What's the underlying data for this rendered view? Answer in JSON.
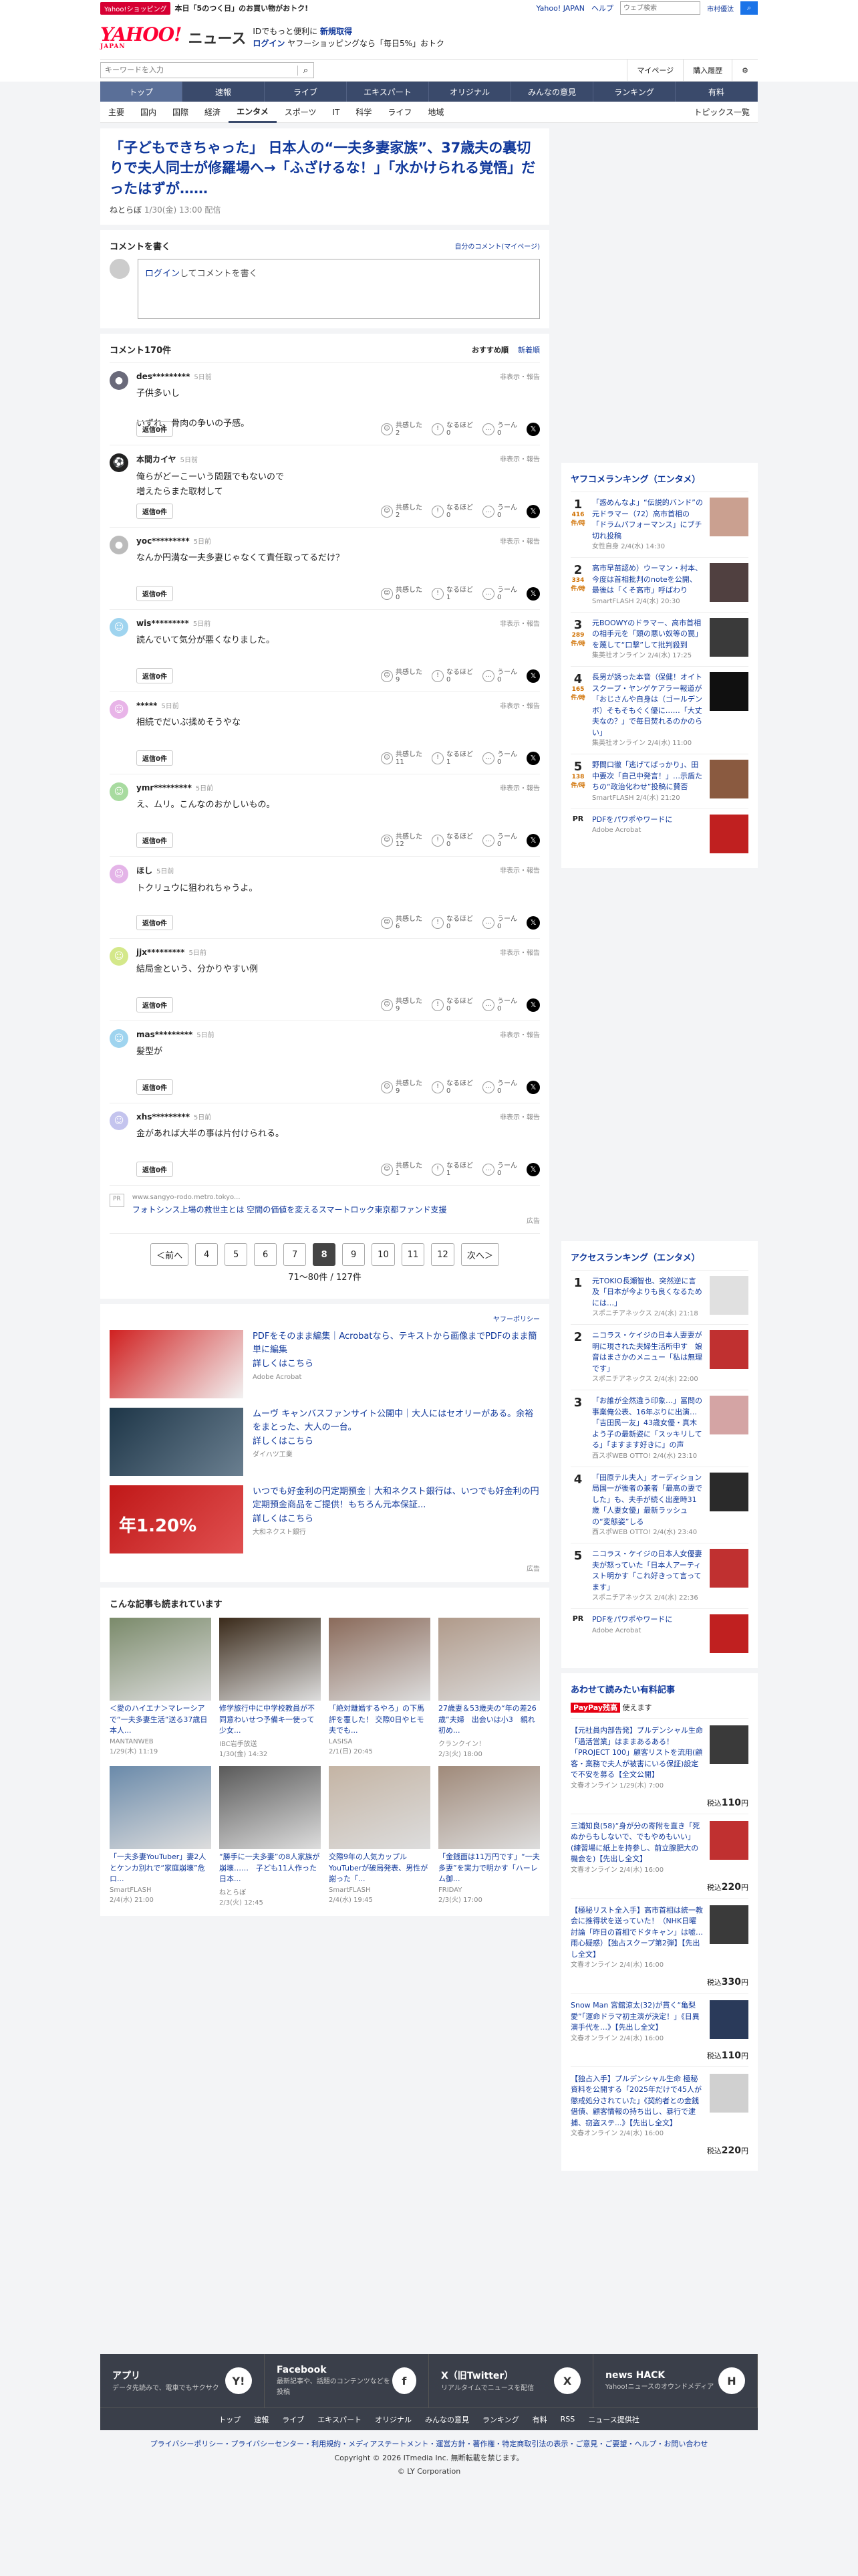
{
  "promo": {
    "tag": "Yahoo!ショッピング",
    "text": "本日「5のつく日」のお買い物がおトク!",
    "links": [
      "Yahoo! JAPAN",
      "ヘルプ"
    ],
    "search_placeholder": "ウェブ検索",
    "search_btn": "市村優汰"
  },
  "header": {
    "logo": "YAHOO!",
    "logo_sub": "JAPAN",
    "brand": "ニュース",
    "msg1": "IDでもっと便利に",
    "msg1b": "新規取得",
    "msg2": "ログイン",
    "msg2b": "ヤフーショッピングなら「毎日5%」おトク"
  },
  "searchbar": {
    "placeholder": "キーワードを入力",
    "links": [
      "マイページ",
      "購入履歴"
    ]
  },
  "nav1": [
    "トップ",
    "速報",
    "ライブ",
    "エキスパート",
    "オリジナル",
    "みんなの意見",
    "ランキング",
    "有料"
  ],
  "nav2": [
    "主要",
    "国内",
    "国際",
    "経済",
    "エンタメ",
    "スポーツ",
    "IT",
    "科学",
    "ライフ",
    "地域"
  ],
  "nav2_right": "トピックス一覧",
  "article": {
    "title": "「子どもできちゃった」 日本人の“一夫多妻家族”、37歳夫の裏切りで夫人同士が修羅場へ→「ふざけるな！」「水かけられる覚悟」だったはずが……",
    "source": "ねとらぼ",
    "date": "1/30(金) 13:00 配信"
  },
  "comment_form": {
    "title": "コメントを書く",
    "mine": "自分のコメント(マイページ)",
    "login": "ログイン",
    "rest": "してコメントを書く"
  },
  "comments_head": {
    "count": "コメント170件",
    "sort_on": "おすすめ順",
    "sort_off": "新着順"
  },
  "comment_labels": {
    "report": "非表示・報告",
    "reply": "返信0件",
    "agree": "共感した",
    "nice": "なるほど",
    "hmm": "うーん"
  },
  "comments": [
    {
      "user": "des*********",
      "time": "5日前",
      "text": "子供多いし\n\nいずれ、骨肉の争いの予感。",
      "a": "2",
      "b": "0",
      "c": "0",
      "color": "#6a6a7a",
      "icon": "●"
    },
    {
      "user": "本間カイヤ",
      "time": "5日前",
      "text": "俺らがどーこーいう問題でもないので\n増えたらまた取材して",
      "a": "2",
      "b": "0",
      "c": "0",
      "color": "#222",
      "icon": "⚽"
    },
    {
      "user": "yoc*********",
      "time": "5日前",
      "text": "なんか円満な一夫多妻じゃなくて責任取ってるだけ？",
      "a": "0",
      "b": "1",
      "c": "0",
      "color": "#bbb",
      "icon": "●"
    },
    {
      "user": "wis*********",
      "time": "5日前",
      "text": "読んでいて気分が悪くなりました。",
      "a": "9",
      "b": "0",
      "c": "0",
      "color": "#9fd4ef",
      "icon": "☺"
    },
    {
      "user": "*****",
      "time": "5日前",
      "text": "相続でだいぶ揉めそうやな",
      "a": "11",
      "b": "1",
      "c": "0",
      "color": "#e8b4e8",
      "icon": "☺"
    },
    {
      "user": "ymr*********",
      "time": "5日前",
      "text": "え、ムリ。こんなのおかしいもの。",
      "a": "12",
      "b": "0",
      "c": "0",
      "color": "#a8dba0",
      "icon": "☺"
    },
    {
      "user": "ほし",
      "time": "5日前",
      "text": "トクリュウに狙われちゃうよ。",
      "a": "6",
      "b": "0",
      "c": "0",
      "color": "#e4b4e8",
      "icon": "☺"
    },
    {
      "user": "jjx*********",
      "time": "5日前",
      "text": "結局金という、分かりやすい例",
      "a": "9",
      "b": "0",
      "c": "0",
      "color": "#d4e88a",
      "icon": "☺"
    },
    {
      "user": "mas*********",
      "time": "5日前",
      "text": "髪型が",
      "a": "9",
      "b": "0",
      "c": "0",
      "color": "#9fd4ef",
      "icon": "☺"
    },
    {
      "user": "xhs*********",
      "time": "5日前",
      "text": "金があれば大半の事は片付けられる。",
      "a": "1",
      "b": "1",
      "c": "0",
      "color": "#c4c4ee",
      "icon": "☺"
    }
  ],
  "pr_strip": {
    "badge": "PR",
    "src": "www.sangyo-rodo.metro.tokyo...",
    "title": "フォトシンス上場の救世主とは 空間の価値を変えるスマートロック東京都ファンド支援",
    "note": "広告"
  },
  "pager": {
    "prev": "＜前へ",
    "pages": [
      "4",
      "5",
      "6",
      "7",
      "8",
      "9",
      "10",
      "11",
      "12"
    ],
    "current": "8",
    "next": "次へ＞",
    "count": "71〜80件 / 127件"
  },
  "ads": {
    "policy": "ヤフーポリシー",
    "items": [
      {
        "title": "PDFをそのまま編集｜Acrobatなら、テキストから画像までPDFのまま簡単に編集",
        "more": "詳しくはこちら",
        "src": "Adobe Acrobat",
        "c1": "#d02020",
        "c2": "#f2f2f2"
      },
      {
        "title": "ムーヴ キャンバスファンサイト公開中｜大人にはセオリーがある。余裕をまとった、大人の一台。",
        "more": "詳しくはこちら",
        "src": "ダイハツ工業",
        "c1": "#1e3648",
        "c2": "#6a7f90"
      },
      {
        "title": "いつでも好金利の円定期預金｜大和ネクスト銀行は、いつでも好金利の円定期預金商品をご提供！もちろん元本保証...",
        "more": "詳しくはこちら",
        "src": "大和ネクスト銀行",
        "c1": "#c01818",
        "c2": "#e05050",
        "rate": "年1.20%"
      }
    ],
    "note": "広告"
  },
  "also": {
    "title": "こんな記事も読まれています",
    "items": [
      {
        "title": "＜愛のハイエナ＞マレーシアで“一夫多妻生活”送る37歳日本人...",
        "src": "MANTANWEB",
        "date": "1/29(木) 11:19",
        "c": "#7a8a6a"
      },
      {
        "title": "修学旅行中に中学校教員が不同意わいせつ予備キ一使って少女...",
        "src": "IBC岩手放送",
        "date": "1/30(金) 14:32",
        "c": "#3a2a1a"
      },
      {
        "title": "「絶対離婚するやろ」の下馬評を覆した！ 交際0日やヒモ夫でも...",
        "src": "LASISA",
        "date": "2/1(日) 20:45",
        "c": "#8a6a5a"
      },
      {
        "title": "27歳妻＆53歳夫の“年の差26歳”夫婦　出会いは小3　親れ初め...",
        "src": "クランクイン！",
        "date": "2/3(火) 18:00",
        "c": "#b09a8a"
      },
      {
        "title": "「一夫多妻YouTuber」妻2人とケンカ別れで“家庭崩壊”危ロ...",
        "src": "SmartFLASH",
        "date": "2/4(水) 21:00",
        "c": "#6a8aaa"
      },
      {
        "title": "“勝手に一夫多妻”の8人家族が崩壊……　子ども11人作った日本...",
        "src": "ねとらぼ",
        "date": "2/3(火) 12:45",
        "c": "#5a5a5a"
      },
      {
        "title": "交際9年の人気カップルYouTuberが破局発表、男性が謝った「...",
        "src": "SmartFLASH",
        "date": "2/4(水) 19:45",
        "c": "#c4b4a4"
      },
      {
        "title": "「金銭面は11万円です」“一夫多妻”を実力で明かす「ハーレム御...",
        "src": "FRIDAY",
        "date": "2/3(火) 17:00",
        "c": "#a08a7a"
      }
    ]
  },
  "ranking": {
    "title": "ヤフコメランキング（エンタメ）",
    "unit": "件/時",
    "items": [
      {
        "n": "1",
        "cnt": "416",
        "title": "「惑めんなよ」“伝説的バンド”の元ドラマー（72）高市首相の「ドラムパフォーマンス」にブチ切れ投稿",
        "src": "女性自身 2/4(水) 14:30",
        "c": "#caa090"
      },
      {
        "n": "2",
        "cnt": "334",
        "title": "高市早苗認め）ウーマン・村本、今度は首相批判のnoteを公開、最後は「くそ高市」呼ばわり",
        "src": "SmartFLASH 2/4(水) 20:30",
        "c": "#504040"
      },
      {
        "n": "3",
        "cnt": "289",
        "title": "元BOOWYのドラマー、高市首相の相手元を「頭の悪い奴等の罠」を蔑して“口撃”して批判殺到",
        "src": "集英社オンライン 2/4(水) 17:25",
        "c": "#3a3a3a"
      },
      {
        "n": "4",
        "cnt": "165",
        "title": "長男が誘った本音（保健！オイトスクープ・ヤンゲケアラー報道が「おじさんや自身は（ゴールデンボ）そもそもぐく優に……「大丈夫なの？」で毎日焚れるのかのらい」",
        "src": "集英社オンライン 2/4(水) 11:00",
        "c": "#101010"
      },
      {
        "n": "5",
        "cnt": "138",
        "title": "野間口徹「逃げてばっかり」、田中要次「自己中発言！」…示盾たちの“政治化わせ”投稿に賛否",
        "src": "SmartFLASH 2/4(水) 21:20",
        "c": "#8a5a40"
      }
    ],
    "pr": {
      "title": "PDFをパワポやワードに",
      "src": "Adobe Acrobat"
    }
  },
  "access": {
    "title": "アクセスランキング（エンタメ）",
    "items": [
      {
        "n": "1",
        "title": "元TOKIO長瀬智也、突然逆に言及「日本が今よりも良くなるためには…」",
        "src": "スポニチアネックス 2/4(水) 21:18",
        "c": "#e0e0e0"
      },
      {
        "n": "2",
        "title": "ニコラス・ケイジの日本人妻妻が明に現された夫婦生活所申す　娘音はまさかのメニュー「私は無理です」",
        "src": "スポニチアネックス 2/4(水) 22:00",
        "c": "#c03030"
      },
      {
        "n": "3",
        "title": "「お誰が全然違う印象…」冨問の事業俺公表、16年ぶりに出演…「吉田民一友」43歳女優・真木よう子の最新姿に「スッキリしてる」「ますます好きに」の声",
        "src": "西スポWEB OTTO! 2/4(水) 23:10",
        "c": "#d4a4a4"
      },
      {
        "n": "4",
        "title": "「田原テル夫人」オーディション局国一が後者の兼者「最高の妻でした」も、夫手が続く出産時31歳「人妻女優」最新ラッシュの“変態姿”しる",
        "src": "西スポWEB OTTO! 2/4(水) 23:40",
        "c": "#2a2a2a"
      },
      {
        "n": "5",
        "title": "ニコラス・ケイジの日本人女優妻夫が怒っていた「日本人アーティスト明かす「これ好きって言ってます」",
        "src": "スポニチアネックス 2/4(水) 22:36",
        "c": "#c03030"
      }
    ],
    "pr": {
      "title": "PDFをパワポやワードに",
      "src": "Adobe Acrobat"
    }
  },
  "paid": {
    "title": "あわせて読みたい有料記事",
    "paypay": "PayPay残高",
    "paypay_note": "使えます",
    "items": [
      {
        "title": "【元社員内部告発】プルデンシャル生命「過活営業」はままあるある！「PROJECT 100」顧客リストを流用(顧客・業務で夫人が被害にいる保証)設定で不安を募る【全文公開】",
        "src": "文春オンライン 1/29(木) 7:00",
        "price": "110",
        "c": "#3a3a3a"
      },
      {
        "title": "三浦知良(58)“身が分の寄附を直き「死ぬからもしないで、でもやめもいい」(練習場に紙上を持参し、前立腺肥大の機会を)【先出し全文】",
        "src": "文春オンライン 2/4(水) 16:00",
        "price": "220",
        "c": "#c03030"
      },
      {
        "title": "【極秘リスト全入手】高市首相は統一教会に推得状を送っていた！（NHK日曜討論「昨日の首相でドタキャン」は嘘…雨心疑惑）【独占スクープ第2弾】【先出し全文】",
        "src": "文春オンライン 2/4(水) 16:00",
        "price": "330",
        "c": "#3a3a3a"
      },
      {
        "title": "Snow Man 宮舘涼太(32)が貫く“亀梨愛”「運命ドラマ初主演が決定！」《日異演手代を…》【先出し全文】",
        "src": "文春オンライン 2/4(水) 16:00",
        "price": "110",
        "c": "#2a3a5a"
      },
      {
        "title": "【独占入手】プルデンシャル生命 極秘資料を公開する「2025年だけで45人が懲戒処分されていた」《契約者との金銭借債、顧客情報の持ち出し、暴行で逮捕、窃盗ステ...》【先出し全文】",
        "src": "文春オンライン 2/4(水) 16:00",
        "price": "220",
        "c": "#d0d0d0"
      }
    ],
    "price_prefix": "税込",
    "price_suffix": "円"
  },
  "footer": {
    "apps": [
      {
        "title": "アプリ",
        "desc": "データ先読みで、電車でもサクサク",
        "icon": "Y!"
      },
      {
        "title": "Facebook",
        "desc": "最新記事や、話題のコンテンツなどを投稿",
        "icon": "f"
      },
      {
        "title": "X（旧Twitter）",
        "desc": "リアルタイムでニュースを配信",
        "icon": "X"
      },
      {
        "title": "news HACK",
        "desc": "Yahoo!ニュースのオウンドメディア",
        "icon": "H"
      }
    ],
    "nav": [
      "トップ",
      "速報",
      "ライブ",
      "エキスパート",
      "オリジナル",
      "みんなの意見",
      "ランキング",
      "有料",
      "RSS",
      "ニュース提供社"
    ],
    "links": "プライバシーポリシー・プライバシーセンター・利用規約・メディアステートメント・運営方針・著作権・特定商取引法の表示・ご意見・ご要望・ヘルプ・お問い合わせ",
    "copy1": "Copyright © 2026 ITmedia Inc. 無断転載を禁じます。",
    "copy2": "© LY Corporation"
  }
}
